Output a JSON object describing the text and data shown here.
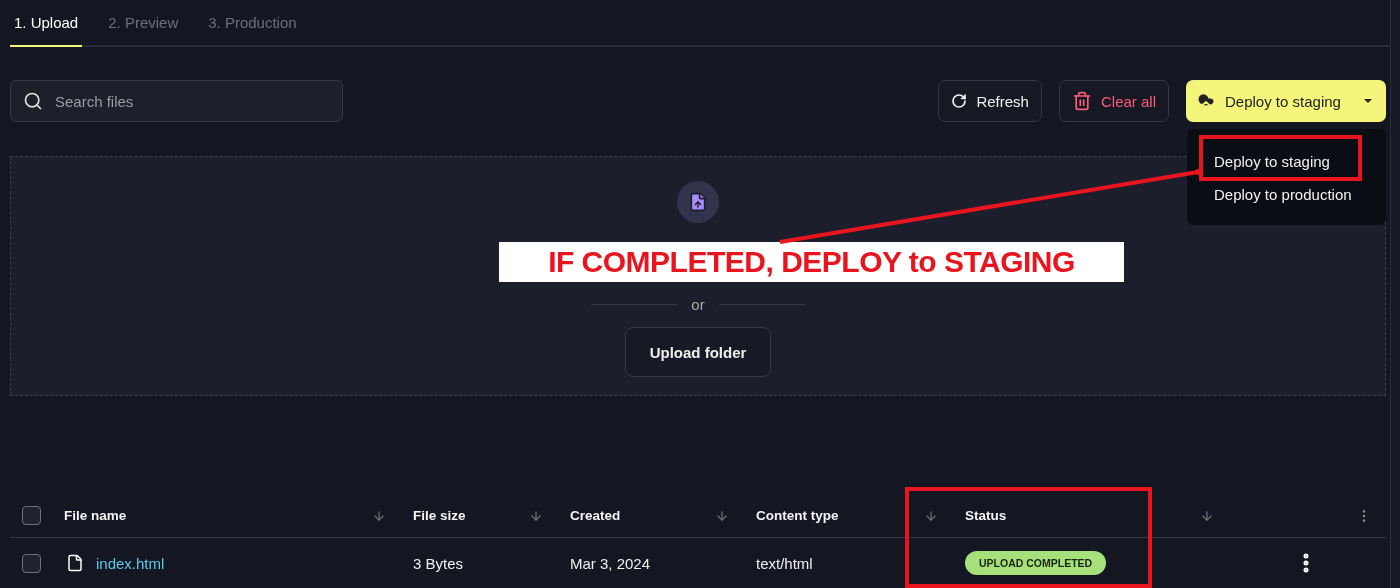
{
  "tabs": [
    {
      "label": "1. Upload",
      "selected": true
    },
    {
      "label": "2. Preview",
      "selected": false
    },
    {
      "label": "3. Production",
      "selected": false
    }
  ],
  "search": {
    "placeholder": "Search files"
  },
  "toolbar": {
    "refresh": "Refresh",
    "clear_all": "Clear all",
    "deploy": "Deploy to staging",
    "deploy_menu": [
      "Deploy to staging",
      "Deploy to production"
    ]
  },
  "dropzone": {
    "separator": "or",
    "button": "Upload folder"
  },
  "annotation": {
    "text": "IF COMPLETED, DEPLOY to STAGING"
  },
  "table": {
    "columns": [
      "File name",
      "File size",
      "Created",
      "Content type",
      "Status"
    ],
    "all_checked": false,
    "rows": [
      {
        "checked": false,
        "name": "index.html",
        "size": "3 Bytes",
        "created": "Mar 3, 2024",
        "content_type": "text/html",
        "status": "UPLOAD COMPLETED"
      }
    ]
  }
}
